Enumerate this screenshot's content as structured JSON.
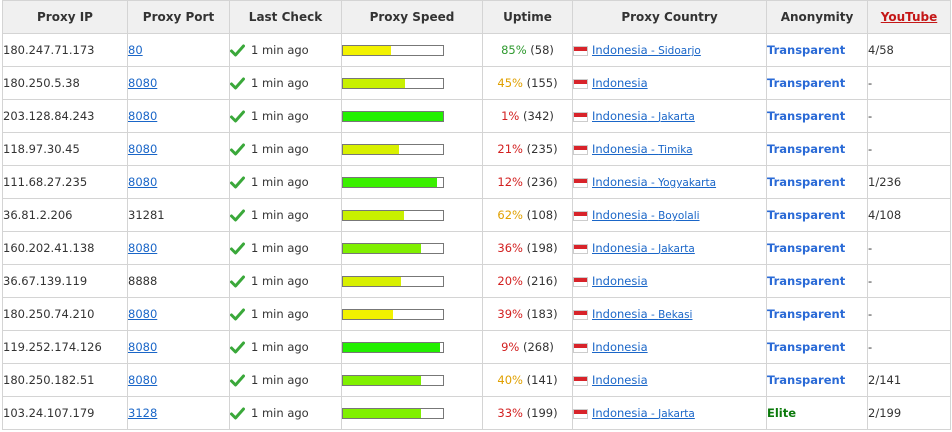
{
  "headers": {
    "ip": "Proxy IP",
    "port": "Proxy Port",
    "check": "Last Check",
    "speed": "Proxy Speed",
    "uptime": "Uptime",
    "country": "Proxy Country",
    "anonymity": "Anonymity",
    "youtube": "YouTube"
  },
  "colors": {
    "speed_yellow": "#f2f200",
    "speed_lime": "#c8f000",
    "speed_light_green": "#80f000",
    "speed_green": "#22f000",
    "uptime_high": "#2f9a2f",
    "uptime_mid": "#e0a000",
    "uptime_low": "#d21f1f",
    "transparent": "#2a6ad6",
    "elite": "#0b7a0b",
    "check_tick": "#3aa83a"
  },
  "rows": [
    {
      "ip": "180.247.71.173",
      "port": "80",
      "port_link": true,
      "check": "1 min ago",
      "speed": 0.48,
      "speed_color": "#f2f200",
      "uptime_pct": "85%",
      "uptime_count": "(58)",
      "uptime_color": "#2f9a2f",
      "country": "Indonesia",
      "city": "Sidoarjo",
      "anonymity": "Transparent",
      "anon_color": "#2a6ad6",
      "youtube": "4/58"
    },
    {
      "ip": "180.250.5.38",
      "port": "8080",
      "port_link": true,
      "check": "1 min ago",
      "speed": 0.62,
      "speed_color": "#c8f000",
      "uptime_pct": "45%",
      "uptime_count": "(155)",
      "uptime_color": "#e0a000",
      "country": "Indonesia",
      "city": "",
      "anonymity": "Transparent",
      "anon_color": "#2a6ad6",
      "youtube": "-"
    },
    {
      "ip": "203.128.84.243",
      "port": "8080",
      "port_link": true,
      "check": "1 min ago",
      "speed": 1.0,
      "speed_color": "#22f000",
      "uptime_pct": "1%",
      "uptime_count": "(342)",
      "uptime_color": "#d21f1f",
      "country": "Indonesia",
      "city": "Jakarta",
      "anonymity": "Transparent",
      "anon_color": "#2a6ad6",
      "youtube": "-"
    },
    {
      "ip": "118.97.30.45",
      "port": "8080",
      "port_link": true,
      "check": "1 min ago",
      "speed": 0.56,
      "speed_color": "#d8f000",
      "uptime_pct": "21%",
      "uptime_count": "(235)",
      "uptime_color": "#d21f1f",
      "country": "Indonesia",
      "city": "Timika",
      "anonymity": "Transparent",
      "anon_color": "#2a6ad6",
      "youtube": "-"
    },
    {
      "ip": "111.68.27.235",
      "port": "8080",
      "port_link": true,
      "check": "1 min ago",
      "speed": 0.94,
      "speed_color": "#3af000",
      "uptime_pct": "12%",
      "uptime_count": "(236)",
      "uptime_color": "#d21f1f",
      "country": "Indonesia",
      "city": "Yogyakarta",
      "anonymity": "Transparent",
      "anon_color": "#2a6ad6",
      "youtube": "1/236"
    },
    {
      "ip": "36.81.2.206",
      "port": "31281",
      "port_link": false,
      "check": "1 min ago",
      "speed": 0.61,
      "speed_color": "#c8f000",
      "uptime_pct": "62%",
      "uptime_count": "(108)",
      "uptime_color": "#e0a000",
      "country": "Indonesia",
      "city": "Boyolali",
      "anonymity": "Transparent",
      "anon_color": "#2a6ad6",
      "youtube": "4/108"
    },
    {
      "ip": "160.202.41.138",
      "port": "8080",
      "port_link": true,
      "check": "1 min ago",
      "speed": 0.78,
      "speed_color": "#80f000",
      "uptime_pct": "36%",
      "uptime_count": "(198)",
      "uptime_color": "#d21f1f",
      "country": "Indonesia",
      "city": "Jakarta",
      "anonymity": "Transparent",
      "anon_color": "#2a6ad6",
      "youtube": "-"
    },
    {
      "ip": "36.67.139.119",
      "port": "8888",
      "port_link": false,
      "check": "1 min ago",
      "speed": 0.58,
      "speed_color": "#d8f000",
      "uptime_pct": "20%",
      "uptime_count": "(216)",
      "uptime_color": "#d21f1f",
      "country": "Indonesia",
      "city": "",
      "anonymity": "Transparent",
      "anon_color": "#2a6ad6",
      "youtube": "-"
    },
    {
      "ip": "180.250.74.210",
      "port": "8080",
      "port_link": true,
      "check": "1 min ago",
      "speed": 0.5,
      "speed_color": "#f2f200",
      "uptime_pct": "39%",
      "uptime_count": "(183)",
      "uptime_color": "#d21f1f",
      "country": "Indonesia",
      "city": "Bekasi",
      "anonymity": "Transparent",
      "anon_color": "#2a6ad6",
      "youtube": "-"
    },
    {
      "ip": "119.252.174.126",
      "port": "8080",
      "port_link": true,
      "check": "1 min ago",
      "speed": 0.97,
      "speed_color": "#22f000",
      "uptime_pct": "9%",
      "uptime_count": "(268)",
      "uptime_color": "#d21f1f",
      "country": "Indonesia",
      "city": "",
      "anonymity": "Transparent",
      "anon_color": "#2a6ad6",
      "youtube": "-"
    },
    {
      "ip": "180.250.182.51",
      "port": "8080",
      "port_link": true,
      "check": "1 min ago",
      "speed": 0.78,
      "speed_color": "#80f000",
      "uptime_pct": "40%",
      "uptime_count": "(141)",
      "uptime_color": "#e0a000",
      "country": "Indonesia",
      "city": "",
      "anonymity": "Transparent",
      "anon_color": "#2a6ad6",
      "youtube": "2/141"
    },
    {
      "ip": "103.24.107.179",
      "port": "3128",
      "port_link": true,
      "check": "1 min ago",
      "speed": 0.78,
      "speed_color": "#80f000",
      "uptime_pct": "33%",
      "uptime_count": "(199)",
      "uptime_color": "#d21f1f",
      "country": "Indonesia",
      "city": "Jakarta",
      "anonymity": "Elite",
      "anon_color": "#0b7a0b",
      "youtube": "2/199"
    }
  ]
}
